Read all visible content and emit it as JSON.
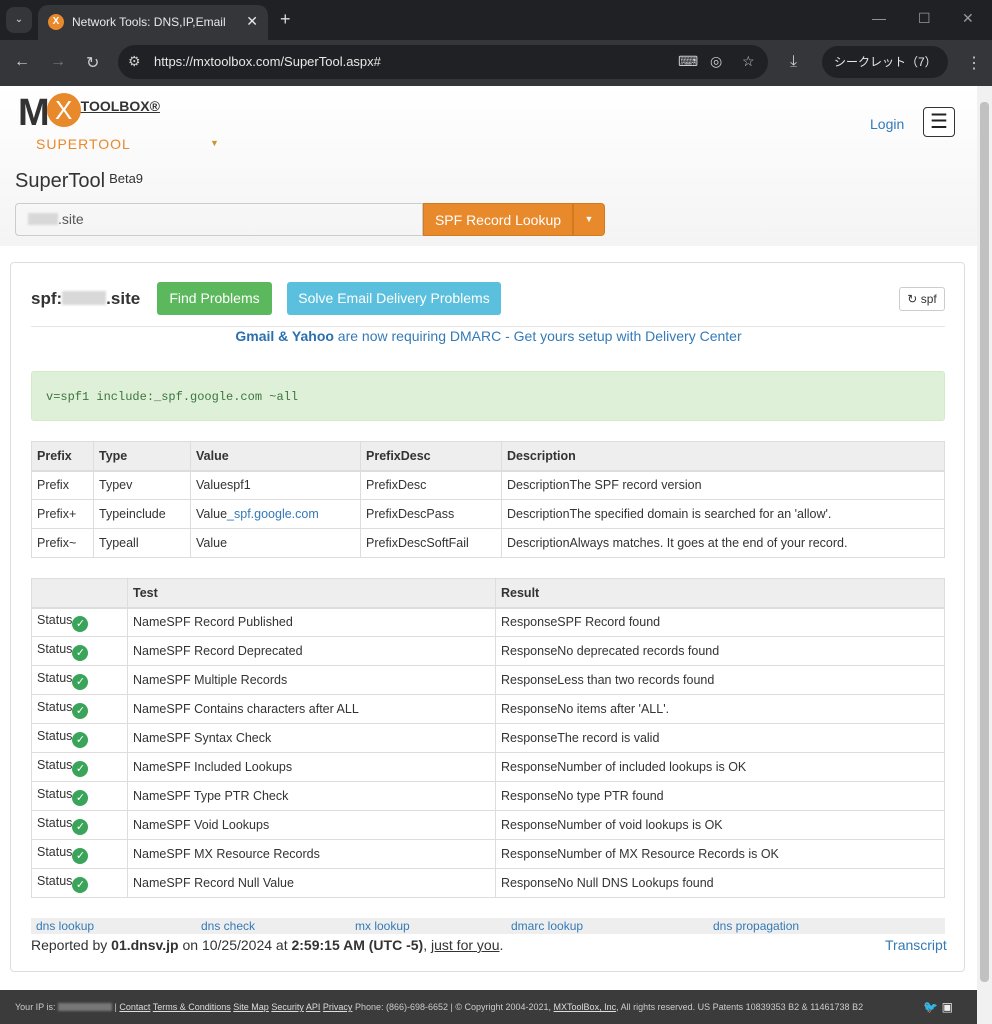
{
  "browser": {
    "tab_title": "Network Tools: DNS,IP,Email",
    "url": "https://mxtoolbox.com/SuperTool.aspx#",
    "incognito": "シークレット（7）"
  },
  "header": {
    "logo_text": "MX TOOLBOX",
    "logo_sub": "SUPERTOOL",
    "login": "Login",
    "title": "SuperTool",
    "beta": "Beta9"
  },
  "search": {
    "value_suffix": ".site",
    "button": "SPF Record Lookup"
  },
  "result": {
    "heading_prefix": "spf:",
    "heading_suffix": ".site",
    "find_problems": "Find Problems",
    "solve": "Solve Email Delivery Problems",
    "refresh": "spf",
    "notice_bold": "Gmail & Yahoo",
    "notice_rest": " are now requiring DMARC - Get yours setup with Delivery Center",
    "record": "v=spf1 include:_spf.google.com ~all"
  },
  "records_table": {
    "headers": [
      "Prefix",
      "Type",
      "Value",
      "PrefixDesc",
      "Description"
    ],
    "rows": [
      [
        "Prefix",
        "Typev",
        "Valuespf1",
        "PrefixDesc",
        "DescriptionThe SPF record version"
      ],
      [
        "Prefix+",
        "Typeinclude",
        "Value_spf.google.com",
        "PrefixDescPass",
        "DescriptionThe specified domain is searched for an 'allow'."
      ],
      [
        "Prefix~",
        "Typeall",
        "Value",
        "PrefixDescSoftFail",
        "DescriptionAlways matches. It goes at the end of your record."
      ]
    ]
  },
  "tests_table": {
    "headers": [
      "",
      "Test",
      "Result"
    ],
    "rows": [
      [
        "Status",
        "NameSPF Record Published",
        "ResponseSPF Record found"
      ],
      [
        "Status",
        "NameSPF Record Deprecated",
        "ResponseNo deprecated records found"
      ],
      [
        "Status",
        "NameSPF Multiple Records",
        "ResponseLess than two records found"
      ],
      [
        "Status",
        "NameSPF Contains characters after ALL",
        "ResponseNo items after 'ALL'."
      ],
      [
        "Status",
        "NameSPF Syntax Check",
        "ResponseThe record is valid"
      ],
      [
        "Status",
        "NameSPF Included Lookups",
        "ResponseNumber of included lookups is OK"
      ],
      [
        "Status",
        "NameSPF Type PTR Check",
        "ResponseNo type PTR found"
      ],
      [
        "Status",
        "NameSPF Void Lookups",
        "ResponseNumber of void lookups is OK"
      ],
      [
        "Status",
        "NameSPF MX Resource Records",
        "ResponseNumber of MX Resource Records is OK"
      ],
      [
        "Status",
        "NameSPF Record Null Value",
        "ResponseNo Null DNS Lookups found"
      ]
    ]
  },
  "links": [
    "dns lookup",
    "dns check",
    "mx lookup",
    "dmarc lookup",
    "dns propagation"
  ],
  "reported": {
    "pre": "Reported by ",
    "server": "01.dnsv.jp",
    "mid": " on 10/25/2024 at ",
    "time": "2:59:15 AM (UTC -5)",
    "sep": ", ",
    "link": "just for you",
    "end": ".",
    "transcript": "Transcript"
  },
  "footer": {
    "ip_label": "Your IP is: ",
    "links": [
      "Contact",
      "Terms & Conditions",
      "Site Map",
      "Security",
      "API",
      "Privacy"
    ],
    "phone": "Phone: (866)-698-6652 | © Copyright 2004-2021, ",
    "company": "MXToolBox, Inc",
    "rights": ", All rights reserved. US Patents 10839353 B2 & 11461738 B2"
  }
}
